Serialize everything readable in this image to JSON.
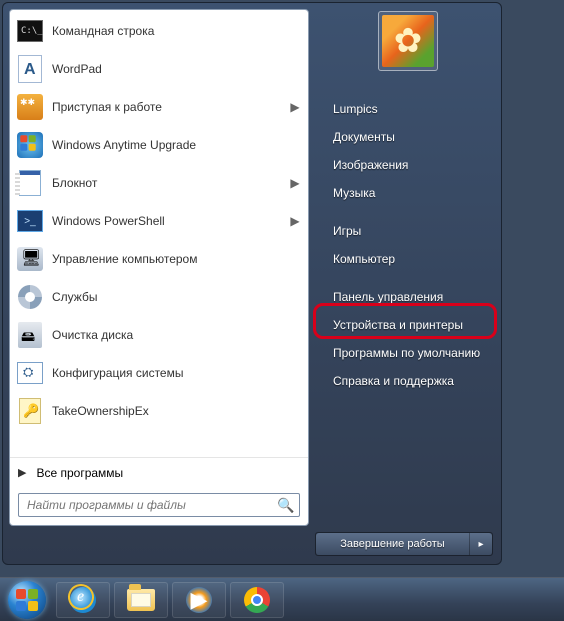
{
  "programs": [
    {
      "label": "Командная строка",
      "has_submenu": false
    },
    {
      "label": "WordPad",
      "has_submenu": false
    },
    {
      "label": "Приступая к работе",
      "has_submenu": true
    },
    {
      "label": "Windows Anytime Upgrade",
      "has_submenu": false
    },
    {
      "label": "Блокнот",
      "has_submenu": true
    },
    {
      "label": "Windows PowerShell",
      "has_submenu": true
    },
    {
      "label": "Управление компьютером",
      "has_submenu": false
    },
    {
      "label": "Службы",
      "has_submenu": false
    },
    {
      "label": "Очистка диска",
      "has_submenu": false
    },
    {
      "label": "Конфигурация системы",
      "has_submenu": false
    },
    {
      "label": "TakeOwnershipEx",
      "has_submenu": false
    }
  ],
  "all_programs_label": "Все программы",
  "search": {
    "placeholder": "Найти программы и файлы"
  },
  "right_links": [
    "Lumpics",
    "Документы",
    "Изображения",
    "Музыка",
    "Игры",
    "Компьютер",
    "Панель управления",
    "Устройства и принтеры",
    "Программы по умолчанию",
    "Справка и поддержка"
  ],
  "shutdown_label": "Завершение работы",
  "taskbar": {
    "pinned": [
      "Пуск",
      "Internet Explorer",
      "Проводник",
      "Windows Media Player",
      "Google Chrome"
    ]
  },
  "highlighted_item": "Панель управления"
}
